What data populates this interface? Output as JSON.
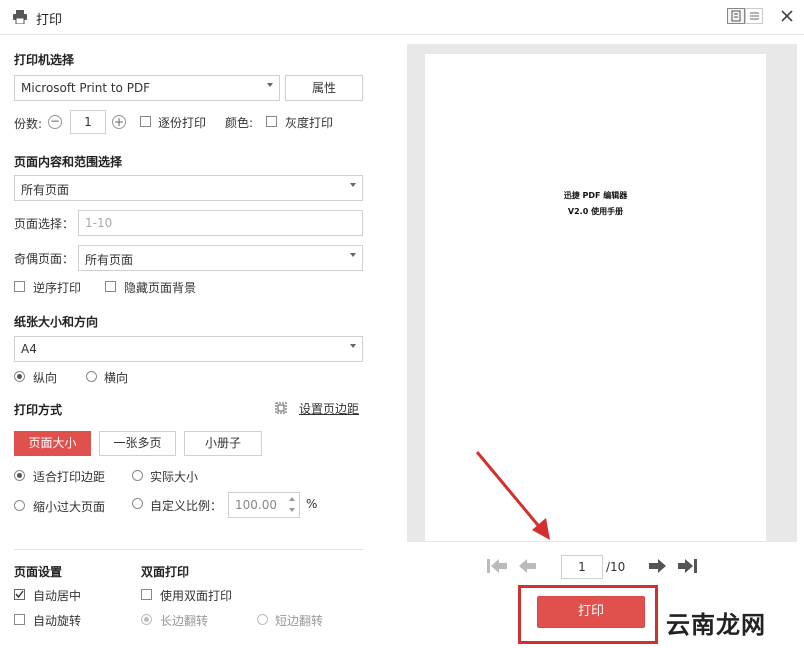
{
  "window": {
    "title": "打印",
    "print_icon": "printer-icon",
    "view_toggle_icons": [
      "single-page-view-icon",
      "list-view-icon"
    ],
    "close_icon": "close-icon"
  },
  "printer": {
    "section_title": "打印机选择",
    "selected": "Microsoft Print to PDF",
    "properties_label": "属性",
    "copies_label": "份数:",
    "copies_value": "1",
    "collate_label": "逐份打印",
    "color_label": "颜色:",
    "grayscale_label": "灰度打印"
  },
  "range": {
    "section_title": "页面内容和范围选择",
    "content_selected": "所有页面",
    "page_select_label": "页面选择：",
    "page_select_placeholder": "1-10",
    "odd_even_label": "奇偶页面：",
    "odd_even_selected": "所有页面",
    "reverse_label": "逆序打印",
    "hide_bg_label": "隐藏页面背景"
  },
  "paper": {
    "section_title": "纸张大小和方向",
    "size_selected": "A4",
    "portrait_label": "纵向",
    "landscape_label": "横向"
  },
  "mode": {
    "section_title": "打印方式",
    "margin_link": "设置页边距",
    "tabs": [
      "页面大小",
      "一张多页",
      "小册子"
    ],
    "fit_margin_label": "适合打印边距",
    "actual_size_label": "实际大小",
    "shrink_label": "缩小过大页面",
    "custom_scale_label": "自定义比例：",
    "scale_value": "100.00",
    "scale_unit": "%"
  },
  "page_settings": {
    "title": "页面设置",
    "auto_center_label": "自动居中",
    "auto_rotate_label": "自动旋转"
  },
  "duplex": {
    "title": "双面打印",
    "use_duplex_label": "使用双面打印",
    "long_edge_label": "长边翻转",
    "short_edge_label": "短边翻转"
  },
  "preview": {
    "line1": "迅捷 PDF 编辑器",
    "line2": "V2.0 使用手册",
    "current_page": "1",
    "total_pages": "/10"
  },
  "actions": {
    "print_label": "打印"
  },
  "watermark": {
    "text": "云南龙网"
  },
  "colors": {
    "accent_red": "#e0514e",
    "annotation_red": "#d32f2f"
  }
}
